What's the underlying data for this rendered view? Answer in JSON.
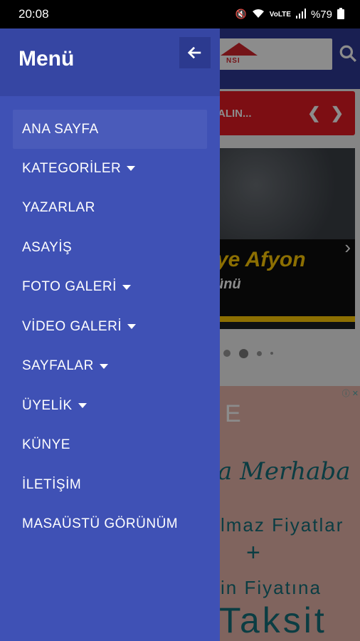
{
  "status_bar": {
    "time": "20:08",
    "battery": "%79",
    "icons": [
      "mute-icon",
      "wifi-icon",
      "volte-icon",
      "signal-icon",
      "battery-icon"
    ]
  },
  "drawer": {
    "title": "Menü",
    "back_icon": "arrow-left-icon",
    "items": [
      {
        "label": "ANA SAYFA",
        "active": true,
        "has_caret": false
      },
      {
        "label": "KATEGORİLER",
        "active": false,
        "has_caret": true
      },
      {
        "label": "YAZARLAR",
        "active": false,
        "has_caret": false
      },
      {
        "label": "ASAYİŞ",
        "active": false,
        "has_caret": false
      },
      {
        "label": "FOTO GALERİ",
        "active": false,
        "has_caret": true
      },
      {
        "label": "VİDEO GALERİ",
        "active": false,
        "has_caret": true
      },
      {
        "label": "SAYFALAR",
        "active": false,
        "has_caret": true
      },
      {
        "label": "ÜYELİK",
        "active": false,
        "has_caret": true
      },
      {
        "label": "KÜNYE",
        "active": false,
        "has_caret": false
      },
      {
        "label": "İLETİŞİM",
        "active": false,
        "has_caret": false
      },
      {
        "label": "MASAÜSTÜ GÖRÜNÜM",
        "active": false,
        "has_caret": false
      }
    ]
  },
  "background": {
    "logo_text": "NSI",
    "ticker_text": "ALIN...",
    "slider_title": "ye Afyon",
    "slider_subtitle": "ünü",
    "ad": {
      "letter": "E",
      "script": "a Merhaba",
      "line1": "lmaz Fiyatlar",
      "plus": "+",
      "line2": "in Fiyatına",
      "line3": "Taksit"
    }
  },
  "colors": {
    "drawer": "#3f51b5",
    "drawer_header": "#3646a3",
    "active_item": "#4a5bba",
    "ticker": "#e31b23",
    "brand_yellow": "#ffcb05"
  }
}
